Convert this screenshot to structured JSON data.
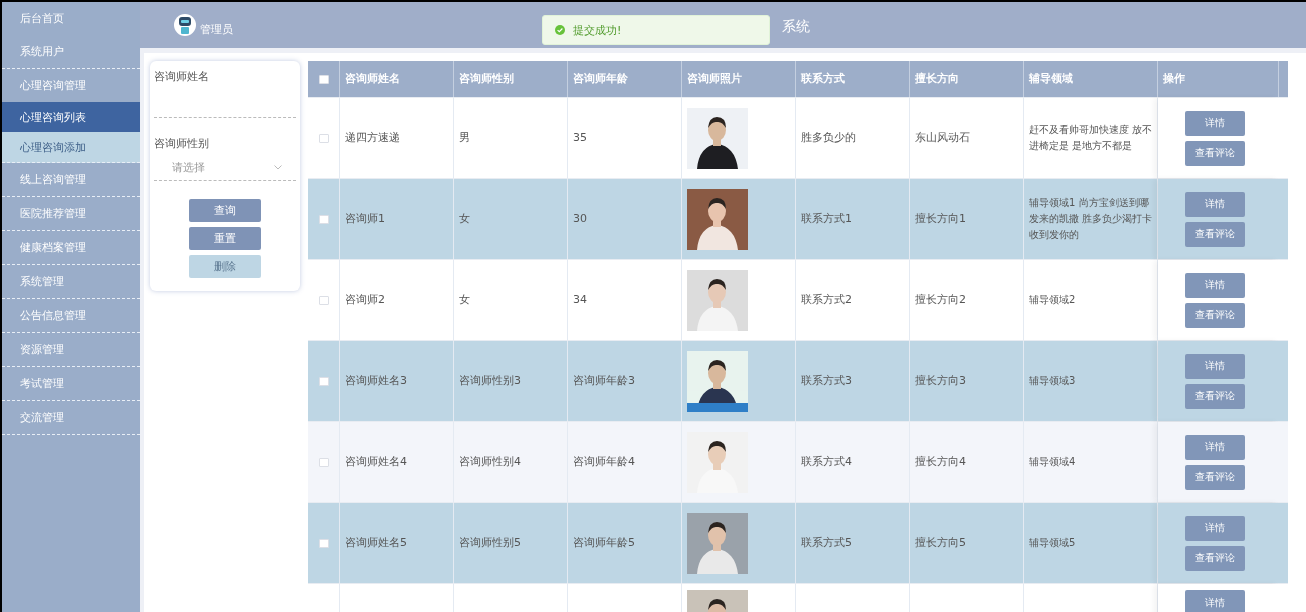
{
  "sidebar": {
    "items": [
      {
        "label": "后台首页",
        "selected": false
      },
      {
        "label": "系统用户",
        "selected": false
      },
      {
        "label": "心理咨询管理",
        "selected": false,
        "expanded": true,
        "children": [
          {
            "label": "心理咨询列表",
            "selected": true
          },
          {
            "label": "心理咨询添加",
            "selected": false
          }
        ]
      },
      {
        "label": "线上咨询管理",
        "selected": false
      },
      {
        "label": "医院推荐管理",
        "selected": false
      },
      {
        "label": "健康档案管理",
        "selected": false
      },
      {
        "label": "系统管理",
        "selected": false
      },
      {
        "label": "公告信息管理",
        "selected": false
      },
      {
        "label": "资源管理",
        "selected": false
      },
      {
        "label": "考试管理",
        "selected": false
      },
      {
        "label": "交流管理",
        "selected": false
      }
    ]
  },
  "header": {
    "user": "管理员",
    "title": "系统"
  },
  "toast": {
    "kind": "success",
    "message": "提交成功!"
  },
  "search": {
    "fields": [
      {
        "kind": "text",
        "label": "咨询师姓名"
      },
      {
        "kind": "select",
        "label": "咨询师性别",
        "placeholder": "请选择"
      }
    ],
    "buttons": [
      {
        "label": "查询",
        "disabled": false
      },
      {
        "label": "重置",
        "disabled": false
      },
      {
        "label": "删除",
        "disabled": true
      }
    ]
  },
  "table": {
    "all_checked": false,
    "columns": [
      "咨询师姓名",
      "咨询师性别",
      "咨询师年龄",
      "咨询师照片",
      "联系方式",
      "擅长方向",
      "辅导领域",
      "操作"
    ],
    "rows": [
      {
        "checked": false,
        "hovered": false,
        "cells": [
          "递四方速递",
          "男",
          "35"
        ],
        "photo": {
          "kind": "picture"
        },
        "contact": "胜多负少的",
        "specialty": "东山风动石",
        "field": "赶不及看帅哥加快速度 放不进椅定是 是地方不都是",
        "actions": [
          "详情",
          "查看评论"
        ]
      },
      {
        "checked": false,
        "hovered": false,
        "cells": [
          "咨询师1",
          "女",
          "30"
        ],
        "photo": {
          "kind": "picture"
        },
        "contact": "联系方式1",
        "specialty": "擅长方向1",
        "field": "辅导领域1 尚方宝剑送到哪发来的凯撒 胜多负少渴打卡收到发你的",
        "actions": [
          "详情",
          "查看评论"
        ]
      },
      {
        "checked": false,
        "hovered": false,
        "cells": [
          "咨询师2",
          "女",
          "34"
        ],
        "photo": {
          "kind": "picture"
        },
        "contact": "联系方式2",
        "specialty": "擅长方向2",
        "field": "辅导领域2",
        "actions": [
          "详情",
          "查看评论"
        ]
      },
      {
        "checked": false,
        "hovered": false,
        "cells": [
          "咨询师姓名3",
          "咨询师性别3",
          "咨询师年龄3"
        ],
        "photo": {
          "kind": "picture"
        },
        "contact": "联系方式3",
        "specialty": "擅长方向3",
        "field": "辅导领域3",
        "actions": [
          "详情",
          "查看评论"
        ]
      },
      {
        "checked": false,
        "hovered": true,
        "cells": [
          "咨询师姓名4",
          "咨询师性别4",
          "咨询师年龄4"
        ],
        "photo": {
          "kind": "picture"
        },
        "contact": "联系方式4",
        "specialty": "擅长方向4",
        "field": "辅导领域4",
        "actions": [
          "详情",
          "查看评论"
        ]
      },
      {
        "checked": false,
        "hovered": false,
        "cells": [
          "咨询师姓名5",
          "咨询师性别5",
          "咨询师年龄5"
        ],
        "photo": {
          "kind": "picture"
        },
        "contact": "联系方式5",
        "specialty": "擅长方向5",
        "field": "辅导领域5",
        "actions": [
          "详情",
          "查看评论"
        ]
      },
      {
        "hovered": false,
        "photo": {
          "kind": "picture"
        },
        "actions": [
          "详情"
        ]
      }
    ]
  }
}
